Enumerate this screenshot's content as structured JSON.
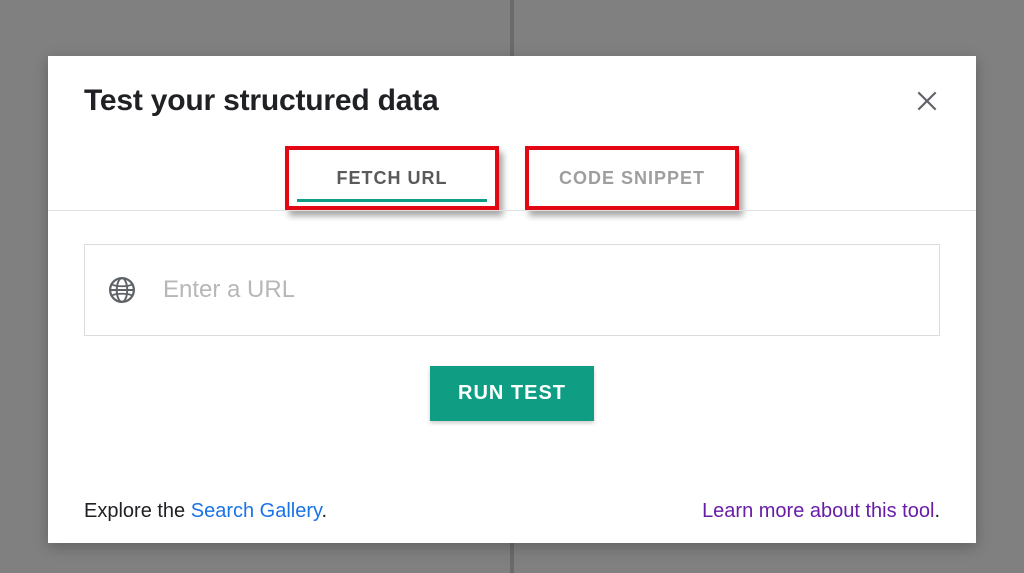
{
  "modal": {
    "title": "Test your structured data",
    "tabs": {
      "fetch_url": "FETCH URL",
      "code_snippet": "CODE SNIPPET"
    },
    "input": {
      "placeholder": "Enter a URL",
      "value": ""
    },
    "run_button": "RUN TEST",
    "footer": {
      "explore_prefix": "Explore the ",
      "search_gallery": "Search Gallery",
      "explore_suffix": ".",
      "learn_more": "Learn more about this tool",
      "learn_more_suffix": "."
    }
  }
}
